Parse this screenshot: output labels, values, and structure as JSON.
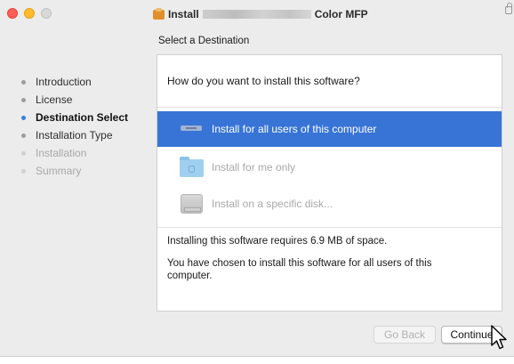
{
  "window": {
    "title_prefix": "Install",
    "title_suffix": "Color MFP"
  },
  "section_title": "Select a Destination",
  "sidebar": {
    "steps": [
      {
        "label": "Introduction",
        "state": "done"
      },
      {
        "label": "License",
        "state": "done"
      },
      {
        "label": "Destination Select",
        "state": "current"
      },
      {
        "label": "Installation Type",
        "state": "pending"
      },
      {
        "label": "Installation",
        "state": "disabled"
      },
      {
        "label": "Summary",
        "state": "disabled"
      }
    ]
  },
  "panel": {
    "question": "How do you want to install this software?",
    "options": [
      {
        "label": "Install for all users of this computer",
        "icon": "computer-icon",
        "selected": true
      },
      {
        "label": "Install for me only",
        "icon": "home-folder-icon",
        "selected": false
      },
      {
        "label": "Install on a specific disk...",
        "icon": "disk-icon",
        "selected": false
      }
    ],
    "space_info": "Installing this software requires 6.9 MB of space.",
    "choice_info": "You have chosen to install this software for all users of this computer."
  },
  "buttons": {
    "back": "Go Back",
    "continue": "Continue"
  },
  "colors": {
    "selection": "#3774d6",
    "current_step_dot": "#3a7de0"
  }
}
